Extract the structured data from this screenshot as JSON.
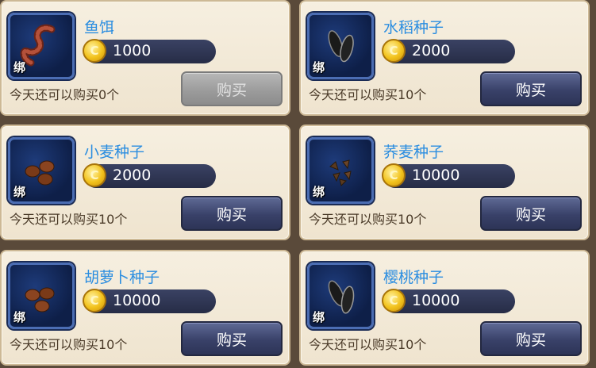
{
  "bind_label": "绑",
  "coin_symbol": "C",
  "items": [
    {
      "name": "鱼饵",
      "price": "1000",
      "quota": "今天还可以购买0个",
      "button": "购买",
      "disabled": true,
      "icon": "worm-bait-icon"
    },
    {
      "name": "水稻种子",
      "price": "2000",
      "quota": "今天还可以购买10个",
      "button": "购买",
      "disabled": false,
      "icon": "rice-seed-icon"
    },
    {
      "name": "小麦种子",
      "price": "2000",
      "quota": "今天还可以购买10个",
      "button": "购买",
      "disabled": false,
      "icon": "wheat-seed-icon"
    },
    {
      "name": "荞麦种子",
      "price": "10000",
      "quota": "今天还可以购买10个",
      "button": "购买",
      "disabled": false,
      "icon": "buckwheat-seed-icon"
    },
    {
      "name": "胡萝卜种子",
      "price": "10000",
      "quota": "今天还可以购买10个",
      "button": "购买",
      "disabled": false,
      "icon": "carrot-seed-icon"
    },
    {
      "name": "樱桃种子",
      "price": "10000",
      "quota": "今天还可以购买10个",
      "button": "购买",
      "disabled": false,
      "icon": "cherry-seed-icon"
    }
  ]
}
